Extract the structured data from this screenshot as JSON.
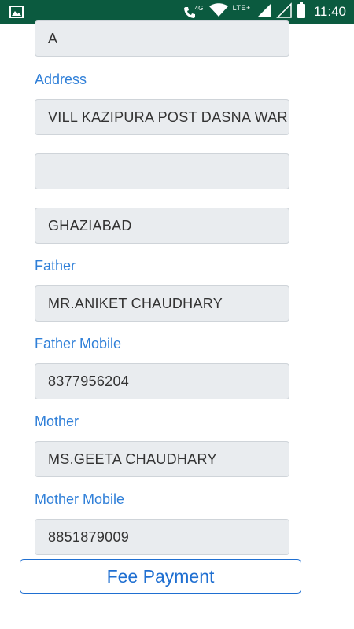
{
  "status_bar": {
    "time": "11:40",
    "network_type": "4G",
    "lte_label": "LTE+",
    "background_color": "#0b5a3f",
    "icons": [
      "gallery-icon",
      "wifi-calling-icon",
      "wifi-icon",
      "cell-signal-icon",
      "battery-icon"
    ]
  },
  "form": {
    "name_value": "A",
    "address": {
      "label": "Address",
      "line1": "VILL KAZIPURA POST DASNA WARD",
      "line2": "",
      "city": "GHAZIABAD"
    },
    "father": {
      "label": "Father",
      "value": "MR.ANIKET CHAUDHARY"
    },
    "father_mobile": {
      "label": "Father Mobile",
      "value": "8377956204"
    },
    "mother": {
      "label": "Mother",
      "value": "MS.GEETA CHAUDHARY"
    },
    "mother_mobile": {
      "label": "Mother Mobile",
      "value": "8851879009"
    }
  },
  "actions": {
    "fee_payment_label": "Fee Payment"
  },
  "colors": {
    "accent": "#2f7fd8",
    "button_border": "#1f6fd1",
    "field_bg": "#e9ecef"
  }
}
